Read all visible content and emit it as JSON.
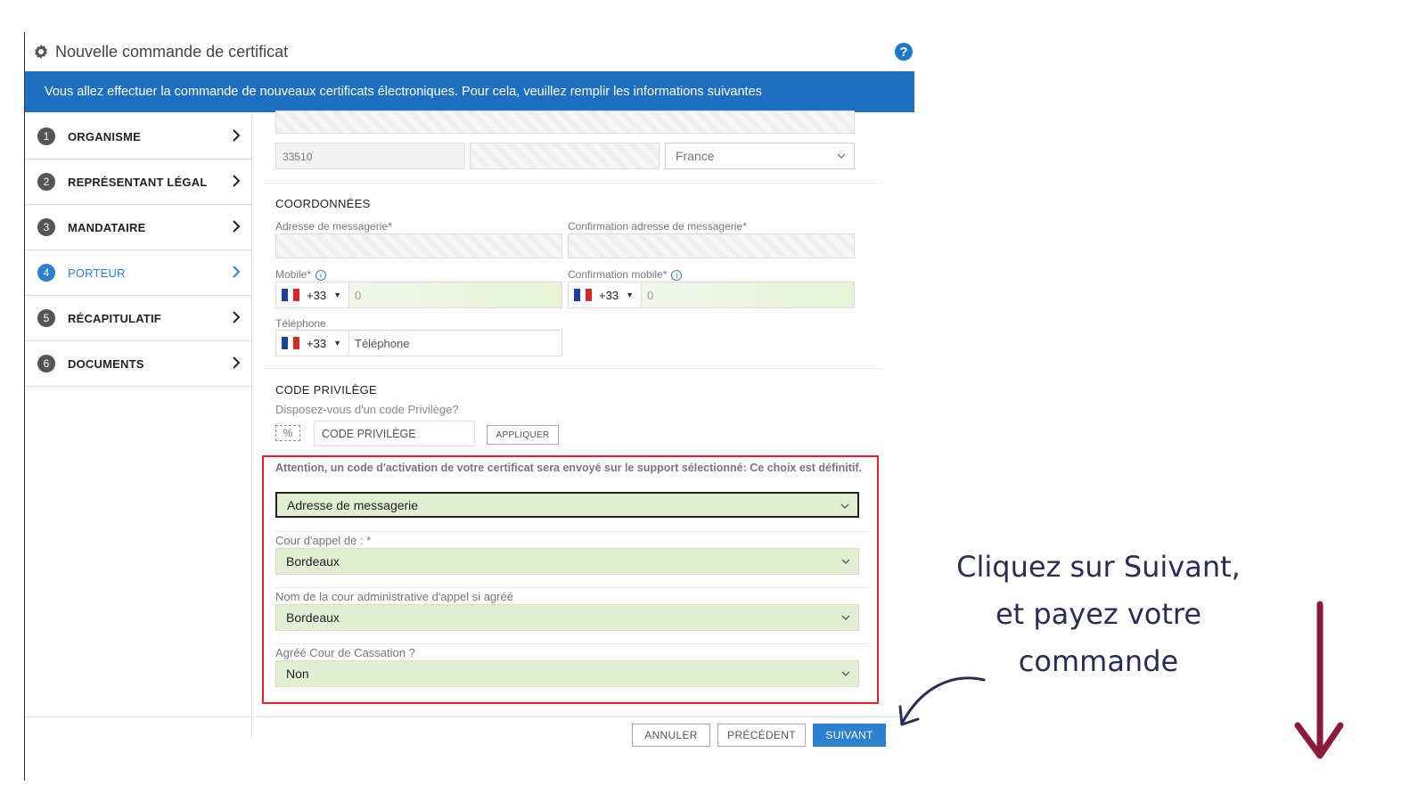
{
  "window": {
    "title": "Nouvelle commande de certificat",
    "help_symbol": "?",
    "banner": "Vous allez effectuer la commande de nouveaux certificats électroniques. Pour cela, veuillez remplir les informations suivantes"
  },
  "steps": [
    {
      "num": "1",
      "label": "ORGANISME"
    },
    {
      "num": "2",
      "label": "REPRÉSENTANT LÉGAL"
    },
    {
      "num": "3",
      "label": "MANDATAIRE"
    },
    {
      "num": "4",
      "label": "PORTEUR"
    },
    {
      "num": "5",
      "label": "RÉCAPITULATIF"
    },
    {
      "num": "6",
      "label": "DOCUMENTS"
    }
  ],
  "address": {
    "postal_code": "33510",
    "country": "France"
  },
  "contact": {
    "section_title": "COORDONNÉES",
    "email_label": "Adresse de messagerie*",
    "email_confirm_label": "Confirmation adresse de messagerie*",
    "mobile_label": "Mobile*",
    "mobile_confirm_label": "Confirmation mobile*",
    "mobile_code": "+33",
    "mobile_value": "0",
    "mobile_confirm_code": "+33",
    "mobile_confirm_value": "0",
    "phone_label": "Téléphone",
    "phone_code": "+33",
    "phone_placeholder": "Téléphone"
  },
  "privilege": {
    "section_title": "CODE PRIVILÈGE",
    "question": "Disposez-vous d'un code Privilège?",
    "icon_text": "%",
    "input_placeholder": "CODE PRIVILÈGE",
    "apply_label": "APPLIQUER"
  },
  "activation": {
    "warning": "Attention, un code d'activation de votre certificat sera envoyé sur le support sélectionné: Ce choix est définitif.",
    "support_value": "Adresse de messagerie",
    "court_label": "Cour d'appel de : *",
    "court_value": "Bordeaux",
    "admin_court_label": "Nom de la cour administrative d'appel si agréé",
    "admin_court_value": "Bordeaux",
    "cassation_label": "Agréé Cour de Cassation ?",
    "cassation_value": "Non"
  },
  "footer": {
    "cancel_label": "ANNULER",
    "previous_label": "PRÉCÉDENT",
    "next_label": "SUIVANT"
  },
  "annotation": {
    "line1": "Cliquez sur Suivant,",
    "line2": "et payez votre",
    "line3": "commande"
  },
  "colors": {
    "banner": "#1e6fbf",
    "active_step": "#2f7fd0",
    "highlight_frame": "#e0242a",
    "field_green": "#e3efd2",
    "annotation_text": "#2b2d55",
    "arrow_maroon": "#8b1a3d"
  }
}
